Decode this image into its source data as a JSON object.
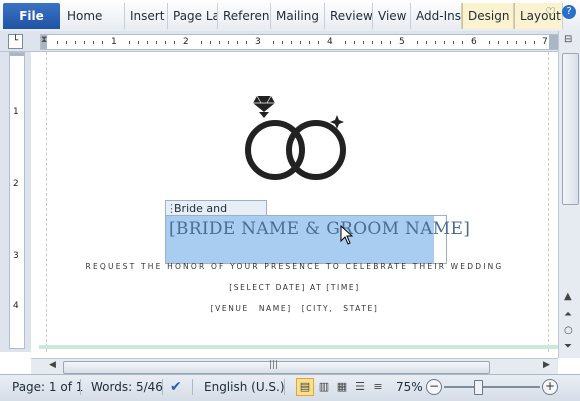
{
  "ribbon": {
    "file_label": "File",
    "tabs": [
      "Home",
      "Insert",
      "Page La",
      "Referen",
      "Mailing",
      "Review",
      "View",
      "Add-Ins"
    ],
    "contextual_tabs": [
      "Design",
      "Layout"
    ]
  },
  "ruler": {
    "h_numbers": [
      "1",
      "2",
      "3",
      "4",
      "5",
      "6",
      "7"
    ],
    "v_numbers": [
      "1",
      "2",
      "3",
      "4"
    ]
  },
  "document": {
    "content_control_title": "Bride and Groom",
    "bride_groom_placeholder": "[BRIDE NAME & GROOM NAME]",
    "line1": "REQUEST THE HONOR OF YOUR PRESENCE TO CELEBRATE THEIR WEDDING",
    "line2": "[SELECT DATE] AT [TIME]",
    "line3": "[VENUE NAME]   [CITY, STATE]"
  },
  "statusbar": {
    "page": "Page: 1 of 1",
    "words": "Words: 5/46",
    "language": "English (U.S.)",
    "zoom": "75%"
  },
  "colors": {
    "selection": "#a8cdf0",
    "file_tab": "#2a5eb0",
    "contextual_tab": "#fbf3cf"
  }
}
